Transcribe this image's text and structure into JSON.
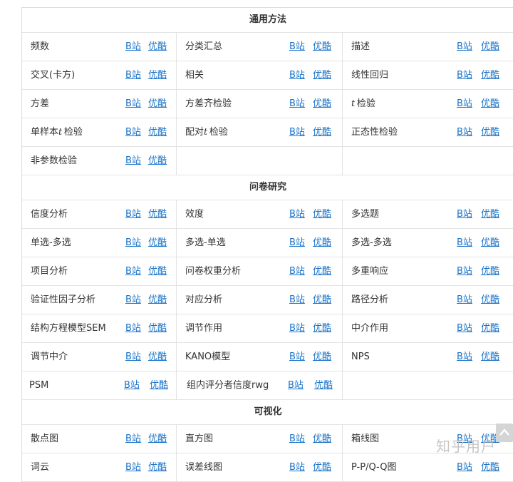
{
  "sections": [
    {
      "title": "通用方法",
      "rows": [
        [
          {
            "name": "频数"
          },
          {
            "name": "分类汇总"
          },
          {
            "name": "描述"
          }
        ],
        [
          {
            "name": "交叉(卡方)"
          },
          {
            "name": "相关"
          },
          {
            "name": "线性回归"
          }
        ],
        [
          {
            "name": "方差"
          },
          {
            "name": "方差齐检验"
          },
          {
            "name": "检验",
            "italic_prefix": "t"
          }
        ],
        [
          {
            "name": "检验",
            "prefix": "单样本",
            "italic_prefix": "t"
          },
          {
            "name": "检验",
            "prefix": "配对",
            "italic_prefix": "t"
          },
          {
            "name": "正态性检验"
          }
        ],
        [
          {
            "name": "非参数检验"
          }
        ]
      ]
    },
    {
      "title": "问卷研究",
      "rows": [
        [
          {
            "name": "信度分析"
          },
          {
            "name": "效度"
          },
          {
            "name": "多选题"
          }
        ],
        [
          {
            "name": "单选-多选"
          },
          {
            "name": "多选-单选"
          },
          {
            "name": "多选-多选"
          }
        ],
        [
          {
            "name": "项目分析"
          },
          {
            "name": "问卷权重分析"
          },
          {
            "name": "多重响应"
          }
        ],
        [
          {
            "name": "验证性因子分析"
          },
          {
            "name": "对应分析"
          },
          {
            "name": "路径分析"
          }
        ],
        [
          {
            "name": "结构方程模型SEM"
          },
          {
            "name": "调节作用"
          },
          {
            "name": "中介作用"
          }
        ],
        [
          {
            "name": "调节中介"
          },
          {
            "name": "KANO模型"
          },
          {
            "name": "NPS"
          }
        ],
        [
          {
            "name": "PSM"
          },
          {
            "name": "组内评分者信度rwg"
          }
        ]
      ]
    },
    {
      "title": "可视化",
      "rows": [
        [
          {
            "name": "散点图"
          },
          {
            "name": "直方图"
          },
          {
            "name": "箱线图"
          }
        ],
        [
          {
            "name": "词云"
          },
          {
            "name": "误差线图"
          },
          {
            "name": "P-P/Q-Q图"
          }
        ]
      ]
    }
  ],
  "links": {
    "bilibili": "B站",
    "youku": "优酷"
  },
  "watermark": "知乎用户",
  "colors": {
    "link": "#1a73c8",
    "border": "#e3e3e3",
    "text": "#333333"
  },
  "icons": {
    "scroll_top": "chevron-up-icon"
  }
}
